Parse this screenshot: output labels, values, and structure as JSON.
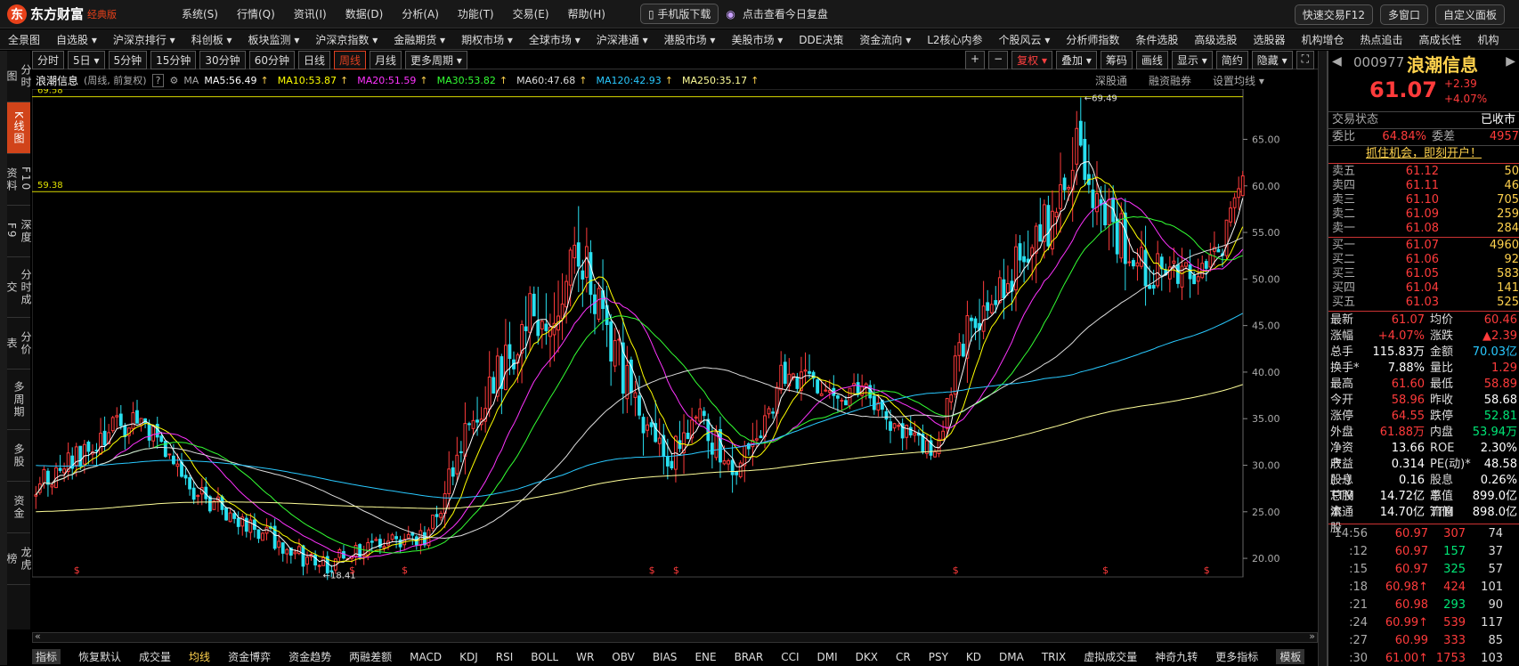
{
  "app": {
    "logo_glyph": "东",
    "name": "东方财富",
    "edition": "经典版",
    "menu": [
      "系统(S)",
      "行情(Q)",
      "资讯(I)",
      "数据(D)",
      "分析(A)",
      "功能(T)",
      "交易(E)",
      "帮助(H)"
    ],
    "mobile_btn": "手机版下载",
    "promo": "点击查看今日复盘",
    "right_buttons": [
      "快速交易F12",
      "多窗口",
      "自定义面板"
    ]
  },
  "navbar": [
    "全景图",
    "自选股 ▾",
    "沪深京排行 ▾",
    "科创板 ▾",
    "板块监测 ▾",
    "沪深京指数 ▾",
    "金融期货 ▾",
    "期权市场 ▾",
    "全球市场 ▾",
    "沪深港通 ▾",
    "港股市场 ▾",
    "美股市场 ▾",
    "DDE决策",
    "资金流向 ▾",
    "L2核心内参",
    "个股风云 ▾",
    "分析师指数",
    "条件选股",
    "高级选股",
    "选股器",
    "机构增仓",
    "热点追击",
    "高成长性",
    "机构"
  ],
  "left_tabs": [
    "分时图",
    "K线图",
    "F10资料",
    "深度F9",
    "分时成交",
    "分价表",
    "多周期",
    "多股",
    "资金",
    "龙虎榜"
  ],
  "left_tab_active": 1,
  "periods": [
    "分时",
    "5日 ▾",
    "5分钟",
    "15分钟",
    "30分钟",
    "60分钟",
    "日线",
    "周线",
    "月线",
    "更多周期 ▾"
  ],
  "period_active": 7,
  "chart_tools": [
    "+",
    "−",
    "复权 ▾",
    "叠加 ▾",
    "筹码",
    "画线",
    "显示 ▾",
    "简约",
    "隐藏 ▾",
    "⛶"
  ],
  "ma_row": {
    "stock_name": "浪潮信息",
    "mode": "(周线, 前复权)",
    "ma_label": "MA",
    "items": [
      {
        "label": "MA5:56.49",
        "color": "#ffffff"
      },
      {
        "label": "MA10:53.87",
        "color": "#ffff00"
      },
      {
        "label": "MA20:51.59",
        "color": "#ff33ff"
      },
      {
        "label": "MA30:53.82",
        "color": "#33ff33"
      },
      {
        "label": "MA60:47.68",
        "color": "#dddddd"
      },
      {
        "label": "MA120:42.93",
        "color": "#29c9ff"
      },
      {
        "label": "MA250:35.17",
        "color": "#ffff99"
      }
    ],
    "right_links": [
      "深股通",
      "融资融券",
      "设置均线 ▾"
    ]
  },
  "chart_data": {
    "type": "candlestick",
    "y_ticks": [
      65,
      60,
      55,
      50,
      45,
      40,
      35,
      30,
      25,
      20
    ],
    "ylim": [
      18.0,
      70.4
    ],
    "h_lines": [
      {
        "label": "69.58",
        "value": 69.58
      },
      {
        "label": "59.38",
        "value": 59.38
      }
    ],
    "annotations": [
      {
        "label": "69.49",
        "value": 69.49
      },
      {
        "label": "18.41",
        "value": 18.41
      }
    ],
    "seed": 977,
    "segments": [
      [
        0,
        28.0,
        2.0
      ],
      [
        20,
        34.0,
        2.5
      ],
      [
        25,
        35.2,
        1.8
      ],
      [
        40,
        27.0,
        2.0
      ],
      [
        55,
        23.0,
        1.6
      ],
      [
        70,
        19.0,
        1.5
      ],
      [
        83,
        21.5,
        1.5
      ],
      [
        97,
        22.5,
        1.6
      ],
      [
        105,
        32.0,
        3.5
      ],
      [
        120,
        45.0,
        5.0
      ],
      [
        135,
        52.0,
        6.0
      ],
      [
        140,
        46.0,
        5.0
      ],
      [
        150,
        35.0,
        4.0
      ],
      [
        157,
        31.0,
        3.5
      ],
      [
        163,
        36.0,
        3.0
      ],
      [
        170,
        30.0,
        3.0
      ],
      [
        177,
        32.0,
        3.0
      ],
      [
        185,
        40.0,
        3.0
      ],
      [
        195,
        37.0,
        2.5
      ],
      [
        205,
        38.0,
        2.0
      ],
      [
        215,
        33.0,
        2.0
      ],
      [
        222,
        31.0,
        1.5
      ],
      [
        230,
        45.0,
        4.0
      ],
      [
        240,
        50.0,
        4.0
      ],
      [
        250,
        56.0,
        5.0
      ],
      [
        258,
        66.0,
        6.0
      ],
      [
        262,
        59.0,
        5.0
      ],
      [
        272,
        51.0,
        4.0
      ],
      [
        282,
        50.0,
        3.0
      ],
      [
        292,
        53.0,
        3.0
      ],
      [
        298,
        61.1,
        3.0
      ]
    ],
    "peak_marker": "↑",
    "s_markers": [
      "$",
      "$",
      "$",
      "$",
      "$",
      "$",
      "$",
      "$"
    ],
    "colors": {
      "up": "#ff3b3b",
      "down": "#29e0f0"
    },
    "ma_periods": [
      5,
      10,
      20,
      30,
      60,
      120,
      250
    ]
  },
  "indicators": [
    "指标",
    "恢复默认",
    "成交量",
    "均线",
    "资金博弈",
    "资金趋势",
    "两融差额",
    "MACD",
    "KDJ",
    "RSI",
    "BOLL",
    "WR",
    "OBV",
    "BIAS",
    "ENE",
    "BRAR",
    "CCI",
    "DMI",
    "DKX",
    "CR",
    "PSY",
    "KD",
    "DMA",
    "TRIX",
    "虚拟成交量",
    "神奇九转",
    "更多指标",
    "模板"
  ],
  "indicator_active": 3,
  "quote": {
    "code": "000977",
    "name": "浪潮信息",
    "price": "61.07",
    "change": "+2.39",
    "change_pct": "+4.07%",
    "status_label": "交易状态",
    "status_value": "已收市",
    "weibi_label": "委比",
    "weibi_value": "64.84%",
    "weicha_label": "委差",
    "weicha_value": "4957",
    "ad": "抓住机会，即刻开户！",
    "asks": [
      {
        "label": "卖五",
        "price": "61.12",
        "vol": "50"
      },
      {
        "label": "卖四",
        "price": "61.11",
        "vol": "46"
      },
      {
        "label": "卖三",
        "price": "61.10",
        "vol": "705"
      },
      {
        "label": "卖二",
        "price": "61.09",
        "vol": "259"
      },
      {
        "label": "卖一",
        "price": "61.08",
        "vol": "284"
      }
    ],
    "bids": [
      {
        "label": "买一",
        "price": "61.07",
        "vol": "4960"
      },
      {
        "label": "买二",
        "price": "61.06",
        "vol": "92"
      },
      {
        "label": "买三",
        "price": "61.05",
        "vol": "583"
      },
      {
        "label": "买四",
        "price": "61.04",
        "vol": "141"
      },
      {
        "label": "买五",
        "price": "61.03",
        "vol": "525"
      }
    ],
    "stats": [
      {
        "k1": "最新",
        "v1": "61.07",
        "c1": "red",
        "k2": "均价",
        "v2": "60.46",
        "c2": "red"
      },
      {
        "k1": "涨幅",
        "v1": "+4.07%",
        "c1": "red",
        "k2": "涨跌",
        "v2": "▲2.39",
        "c2": "red"
      },
      {
        "k1": "总手",
        "v1": "115.83万",
        "c1": "white",
        "k2": "金额",
        "v2": "70.03亿",
        "c2": "cyan"
      },
      {
        "k1": "换手*",
        "v1": "7.88%",
        "c1": "white",
        "k2": "量比",
        "v2": "1.29",
        "c2": "red"
      },
      {
        "k1": "最高",
        "v1": "61.60",
        "c1": "red",
        "k2": "最低",
        "v2": "58.89",
        "c2": "red"
      },
      {
        "k1": "今开",
        "v1": "58.96",
        "c1": "red",
        "k2": "昨收",
        "v2": "58.68",
        "c2": "white"
      },
      {
        "k1": "涨停",
        "v1": "64.55",
        "c1": "red",
        "k2": "跌停",
        "v2": "52.81",
        "c2": "green"
      },
      {
        "k1": "外盘",
        "v1": "61.88万",
        "c1": "red",
        "k2": "内盘",
        "v2": "53.94万",
        "c2": "green"
      },
      {
        "k1": "净资产",
        "v1": "13.66",
        "c1": "white",
        "k2": "ROE",
        "v2": "2.30%",
        "c2": "white"
      },
      {
        "k1": "收益(一)",
        "v1": "0.314",
        "c1": "white",
        "k2": "PE(动)*",
        "v2": "48.58",
        "c2": "white"
      },
      {
        "k1": "股息TTM",
        "v1": "0.16",
        "c1": "white",
        "k2": "股息率TTM",
        "v2": "0.26%",
        "c2": "white"
      },
      {
        "k1": "总股本",
        "v1": "14.72亿",
        "c1": "white",
        "k2": "总值",
        "v2": "899.0亿",
        "c2": "white"
      },
      {
        "k1": "流通股",
        "v1": "14.70亿",
        "c1": "white",
        "k2": "流值",
        "v2": "898.0亿",
        "c2": "white"
      }
    ],
    "ticks": [
      {
        "t": "14:56",
        "p": "60.97",
        "v": "307",
        "vc": "red",
        "c": "74"
      },
      {
        "t": ":12",
        "p": "60.97",
        "v": "157",
        "vc": "green",
        "c": "37"
      },
      {
        "t": ":15",
        "p": "60.97",
        "v": "325",
        "vc": "green",
        "c": "57"
      },
      {
        "t": ":18",
        "p": "60.98↑",
        "v": "424",
        "vc": "red",
        "c": "101"
      },
      {
        "t": ":21",
        "p": "60.98",
        "v": "293",
        "vc": "green",
        "c": "90"
      },
      {
        "t": ":24",
        "p": "60.99↑",
        "v": "539",
        "vc": "red",
        "c": "117"
      },
      {
        "t": ":27",
        "p": "60.99",
        "v": "333",
        "vc": "red",
        "c": "85"
      },
      {
        "t": ":30",
        "p": "61.00↑",
        "v": "1753",
        "vc": "red",
        "c": "103"
      }
    ]
  }
}
